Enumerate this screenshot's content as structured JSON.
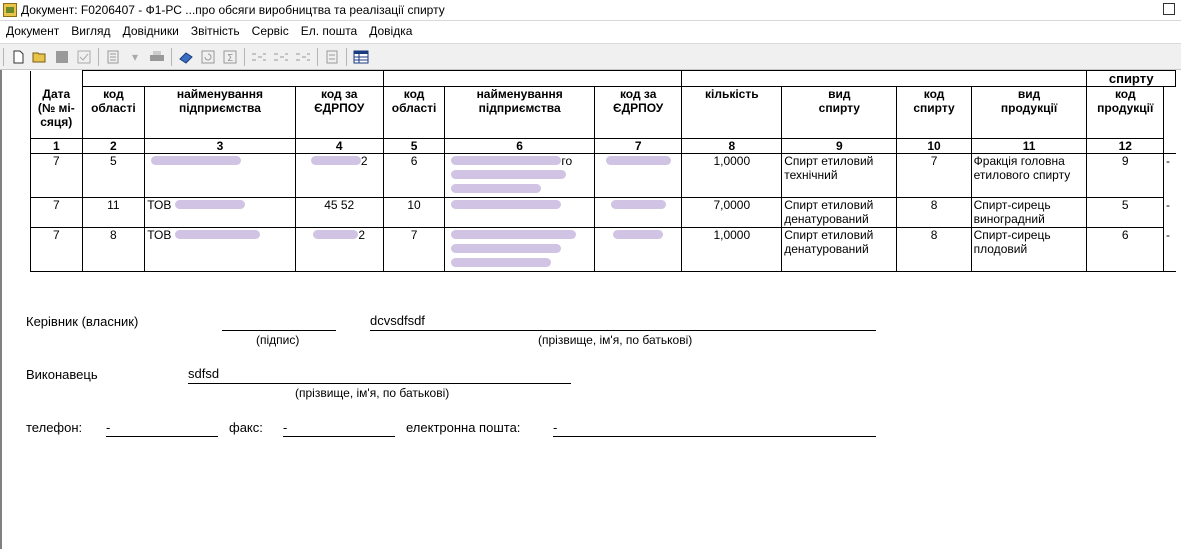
{
  "window": {
    "title": "Документ: F0206407 - Ф1-РС  ...про обсяги виробництва та реалізації спирту"
  },
  "menu": [
    "Документ",
    "Вигляд",
    "Довідники",
    "Звітність",
    "Сервіс",
    "Ел. пошта",
    "Довідка"
  ],
  "toolbar_icons": [
    "new-icon",
    "open-icon",
    "save-icon",
    "check-icon",
    "list-icon",
    "print-icon",
    "eraser-icon",
    "refresh-icon",
    "sum-icon",
    "grid-icon",
    "grid2-icon",
    "grid3-icon",
    "calc-icon",
    "table-icon"
  ],
  "table": {
    "group_header": "спирту",
    "headers": [
      "Дата\n(№ мі-\nсяця)",
      "код\nобласті",
      "найменування\nпідприємства",
      "код за\nЄДРПОУ",
      "код\nобласті",
      "найменування\nпідприємства",
      "код за\nЄДРПОУ",
      "кількість",
      "вид\nспирту",
      "код\nспирту",
      "вид\nпродукції",
      "код\nпродукції"
    ],
    "col_numbers": [
      "1",
      "2",
      "3",
      "4",
      "5",
      "6",
      "7",
      "8",
      "9",
      "10",
      "11",
      "12"
    ],
    "rows": [
      {
        "c1": "7",
        "c2": "5",
        "c3": "",
        "c4": "2",
        "c5": "6",
        "c6": "го",
        "c7": "",
        "c8": "1,0000",
        "c9": "Спирт етиловий технічний",
        "c10": "7",
        "c11": "Фракція головна етилового спирту",
        "c12": "9",
        "c13": "-"
      },
      {
        "c1": "7",
        "c2": "11",
        "c3": "ТОВ",
        "c4": "45 52",
        "c5": "10",
        "c6": "",
        "c7": "",
        "c8": "7,0000",
        "c9": "Спирт етиловий денатурований",
        "c10": "8",
        "c11": "Спирт-сирець виноградний",
        "c12": "5",
        "c13": "-"
      },
      {
        "c1": "7",
        "c2": "8",
        "c3": "ТОВ",
        "c4": "2",
        "c5": "7",
        "c6": "",
        "c7": "",
        "c8": "1,0000",
        "c9": "Спирт етиловий денатурований",
        "c10": "8",
        "c11": "Спирт-сирець плодовий",
        "c12": "6",
        "c13": "-"
      }
    ]
  },
  "form": {
    "head_label": "Керівник (власник)",
    "sign_caption": "(підпис)",
    "head_name": "dcvsdfsdf",
    "fio_caption": "(прізвище, ім'я, по батькові)",
    "executor_label": "Виконавець",
    "executor_name": "sdfsd",
    "executor_caption": "(прізвище, ім'я, по батькові)",
    "phone_label": "телефон:",
    "phone_value": "-",
    "fax_label": "факс:",
    "fax_value": "-",
    "email_label": "електронна пошта:",
    "email_value": "-"
  }
}
